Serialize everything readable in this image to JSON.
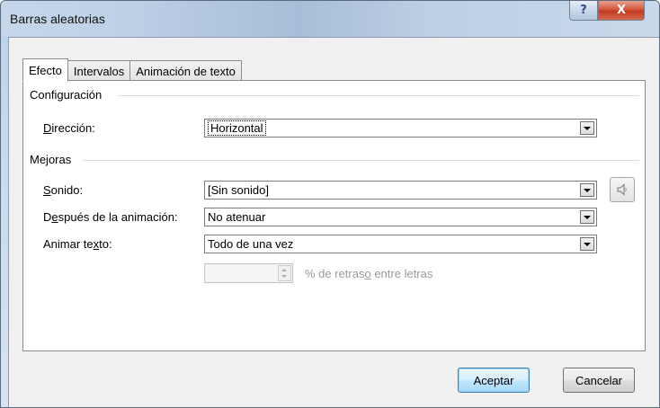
{
  "window": {
    "title": "Barras aleatorias",
    "help_glyph": "?",
    "close_glyph": "X"
  },
  "tabs": [
    {
      "label": "Efecto",
      "active": true
    },
    {
      "label": "Intervalos",
      "active": false
    },
    {
      "label": "Animación de texto",
      "active": false
    }
  ],
  "configuracion": {
    "group_title": "Configuración",
    "direccion": {
      "label_pre": "",
      "label_key": "D",
      "label_post": "irección:",
      "value": "Horizontal"
    }
  },
  "mejoras": {
    "group_title": "Mejoras",
    "sonido": {
      "label_pre": "",
      "label_key": "S",
      "label_post": "onido:",
      "value": "[Sin sonido]"
    },
    "despues": {
      "label_pre": "D",
      "label_key": "e",
      "label_post": "spués de la animación:",
      "value": "No atenuar"
    },
    "animar": {
      "label_pre": "Animar te",
      "label_key": "x",
      "label_post": "to:",
      "value": "Todo de una vez"
    },
    "retraso": {
      "value": "",
      "label_pre": "% de retras",
      "label_key": "o",
      "label_post": " entre letras"
    }
  },
  "buttons": {
    "ok": "Aceptar",
    "cancel": "Cancelar"
  },
  "icons": {
    "help": "help-icon",
    "close": "close-icon",
    "speaker": "speaker-icon",
    "dropdown": "chevron-down-icon"
  },
  "colors": {
    "default_button_border": "#3c7fb1",
    "close_button": "#c23a1f",
    "disabled_text": "#9a9a9a"
  }
}
